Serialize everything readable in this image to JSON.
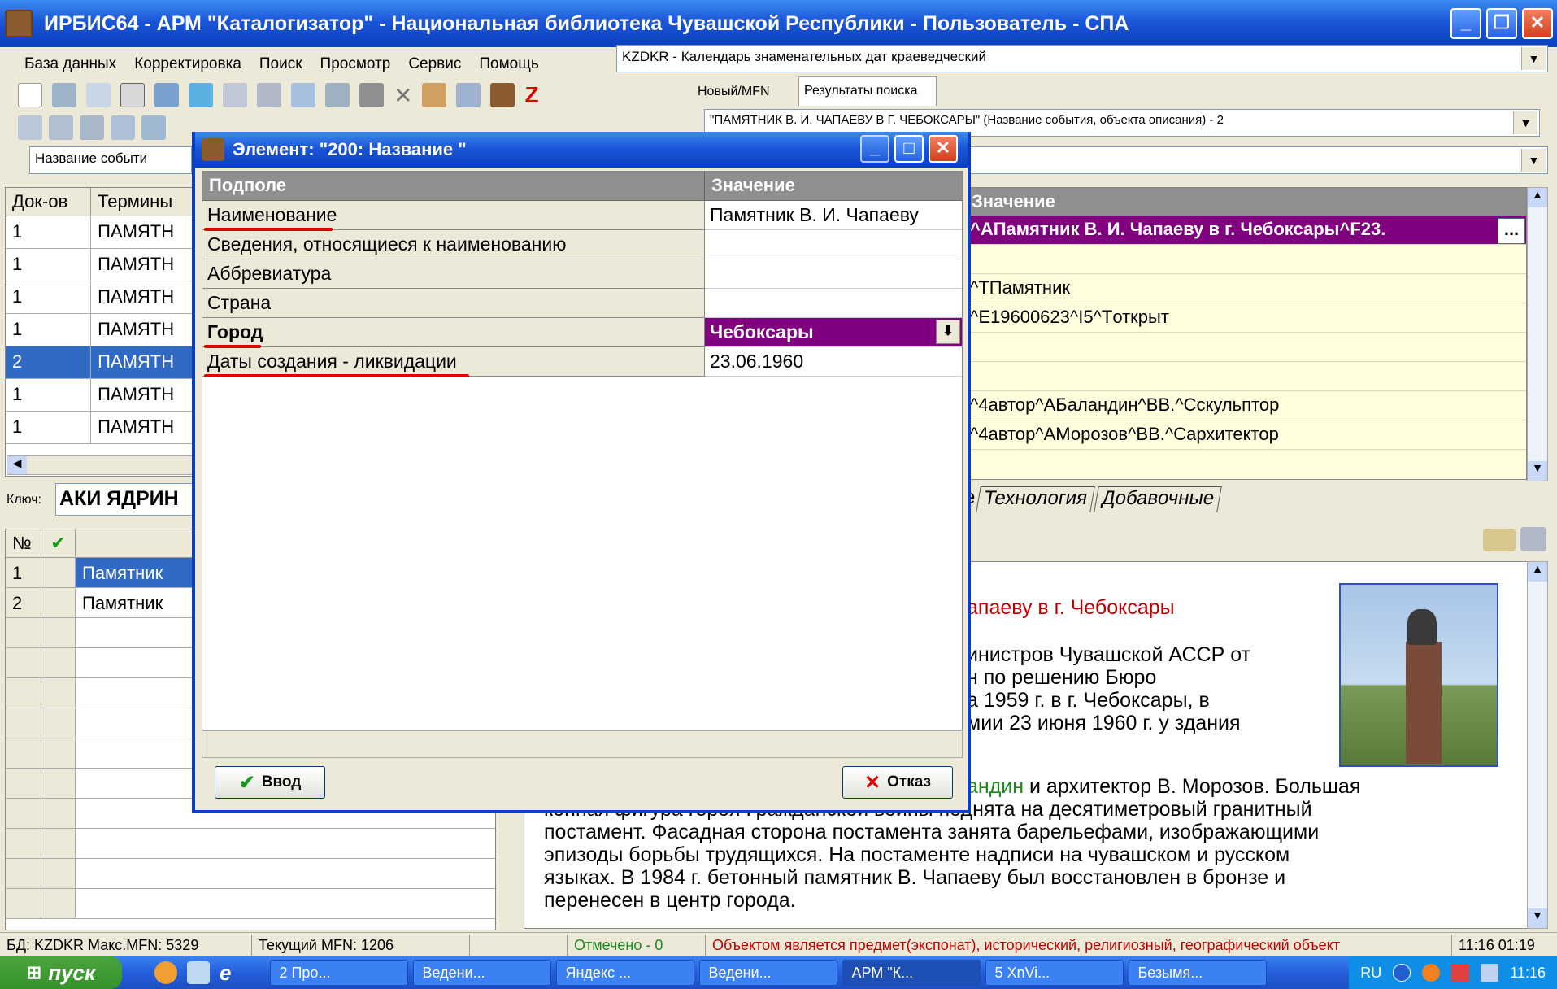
{
  "window": {
    "title": "ИРБИС64 - АРМ \"Каталогизатор\" - Национальная библиотека Чувашской Республики - Пользователь - СПА"
  },
  "menu": [
    "База данных",
    "Корректировка",
    "Поиск",
    "Просмотр",
    "Сервис",
    "Помощь"
  ],
  "database_combo": "KZDKR - Календарь знаменательных дат краеведческий",
  "tabs": {
    "new_mfn": "Новый/MFN",
    "search_results": "Результаты поиска"
  },
  "search_combo": "\"ПАМЯТНИК В. И. ЧАПАЕВУ В Г. ЧЕБОКСАРЫ\" (Название события, объекта описания) - 2",
  "search_field_combo": "Название событи",
  "dict_table": {
    "headers": [
      "Док-ов",
      "Термины"
    ],
    "rows": [
      {
        "count": "1",
        "term": "ПАМЯТН"
      },
      {
        "count": "1",
        "term": "ПАМЯТН"
      },
      {
        "count": "1",
        "term": "ПАМЯТН"
      },
      {
        "count": "1",
        "term": "ПАМЯТН"
      },
      {
        "count": "2",
        "term": "ПАМЯТН"
      },
      {
        "count": "1",
        "term": "ПАМЯТН"
      },
      {
        "count": "1",
        "term": "ПАМЯТН"
      }
    ]
  },
  "key": {
    "label": "Ключ:",
    "value": "АКИ ЯДРИН"
  },
  "results_table": {
    "headers": [
      "№"
    ],
    "rows": [
      {
        "num": "1",
        "title": "Памятник"
      },
      {
        "num": "2",
        "title": "Памятник"
      }
    ]
  },
  "record_editor": {
    "header": "Значение",
    "rows": [
      "^AПамятник В. И. Чапаеву в г. Чебоксары^F23.",
      "",
      "^TПамятник",
      "^E19600623^I5^Tоткрыт",
      "",
      "",
      "^4автор^AБаландин^BB.^Cскульптор",
      "^4автор^AМорозов^BB.^Cархитектор"
    ],
    "ellipsis": "...",
    "tabs": [
      "е",
      "Технология",
      "Добавочные"
    ]
  },
  "description": {
    "title_fragment": "апаеву в г. Чебоксары",
    "lines_partial": [
      "инистров Чувашской АССР от",
      "н по решению Бюро",
      "а 1959 г. в г. Чебоксары, в",
      "мии 23 июня 1960 г. у здания"
    ],
    "author_fragment": "андин",
    "author_rest": " и архитектор В. Морозов. Большая",
    "lines_full": [
      "конная фигура героя Гражданской войны поднята на десятиметровый гранитный",
      "постамент. Фасадная сторона постамента занята барельефами, изображающими",
      "эпизоды борьбы трудящихся. На постаменте надписи на чувашском и русском",
      "языках. В 1984 г. бетонный памятник В. Чапаеву был восстановлен в бронзе и",
      "перенесен в центр города."
    ]
  },
  "dialog": {
    "title": "Элемент: \"200: Название \"",
    "col_subfield": "Подполе",
    "col_value": "Значение",
    "rows": [
      {
        "label": "Наименование",
        "value": "Памятник В. И. Чапаеву"
      },
      {
        "label": "Сведения, относящиеся к наименованию",
        "value": ""
      },
      {
        "label": "Аббревиатура",
        "value": ""
      },
      {
        "label": "Страна",
        "value": ""
      },
      {
        "label": "Город",
        "value": "Чебоксары"
      },
      {
        "label": "Даты создания - ликвидации",
        "value": "23.06.1960"
      }
    ],
    "ok_label": "Ввод",
    "cancel_label": "Отказ"
  },
  "status": {
    "db": "БД: KZDKR Макс.MFN: 5329",
    "current_mfn": "Текущий MFN: 1206",
    "marked": "Отмечено - 0",
    "hint": "Объектом является предмет(экспонат), исторический, религиозный, географический объект",
    "time": "11:16 01:19"
  },
  "taskbar": {
    "start": "пуск",
    "tasks": [
      "2 Про...",
      "Ведени...",
      "Яндекс ...",
      "Ведени...",
      "АРМ \"К...",
      "5 XnVi...",
      "Безымя..."
    ],
    "lang": "RU",
    "clock": "11:16"
  },
  "colors": {
    "accent": "#0a3fbe",
    "selected": "#316ac5",
    "purple": "#800080",
    "red_text": "#c00000",
    "green_text": "#008000"
  }
}
